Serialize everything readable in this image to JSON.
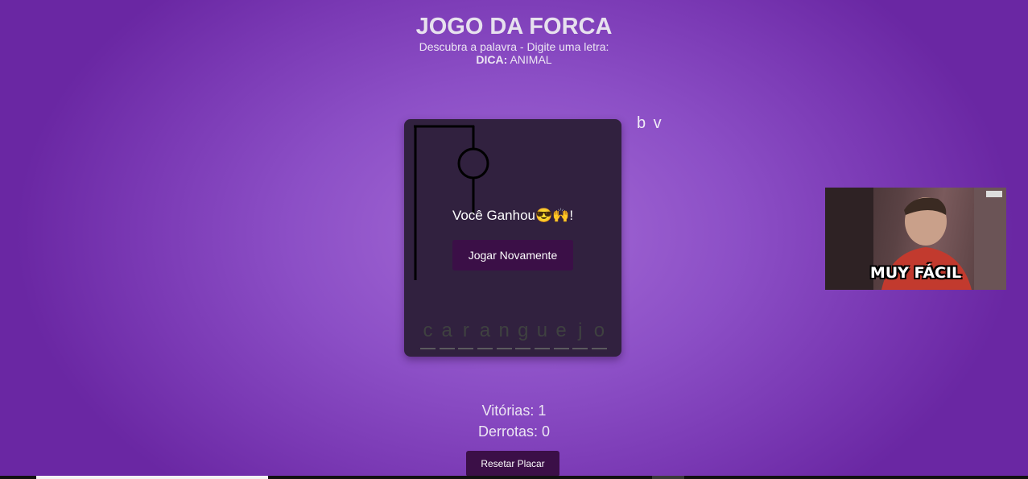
{
  "header": {
    "title": "JOGO DA FORCA",
    "subtitle": "Descubra a palavra - Digite uma letra:",
    "hint_label": "DICA:",
    "hint_value": "ANIMAL"
  },
  "game": {
    "word_letters": [
      "c",
      "a",
      "r",
      "a",
      "n",
      "g",
      "u",
      "e",
      "j",
      "o"
    ],
    "wrong_letters": "b v",
    "result_text": "Você Ganhou😎🙌!",
    "play_again_label": "Jogar Novamente"
  },
  "score": {
    "wins_label": "Vitórias:",
    "wins_value": "1",
    "losses_label": "Derrotas:",
    "losses_value": "0",
    "reset_label": "Resetar Placar"
  },
  "gif": {
    "caption": "MUY FÁCIL"
  },
  "colors": {
    "background": "#8c4fc6",
    "board": "#31213f",
    "button": "#3b0f47"
  }
}
